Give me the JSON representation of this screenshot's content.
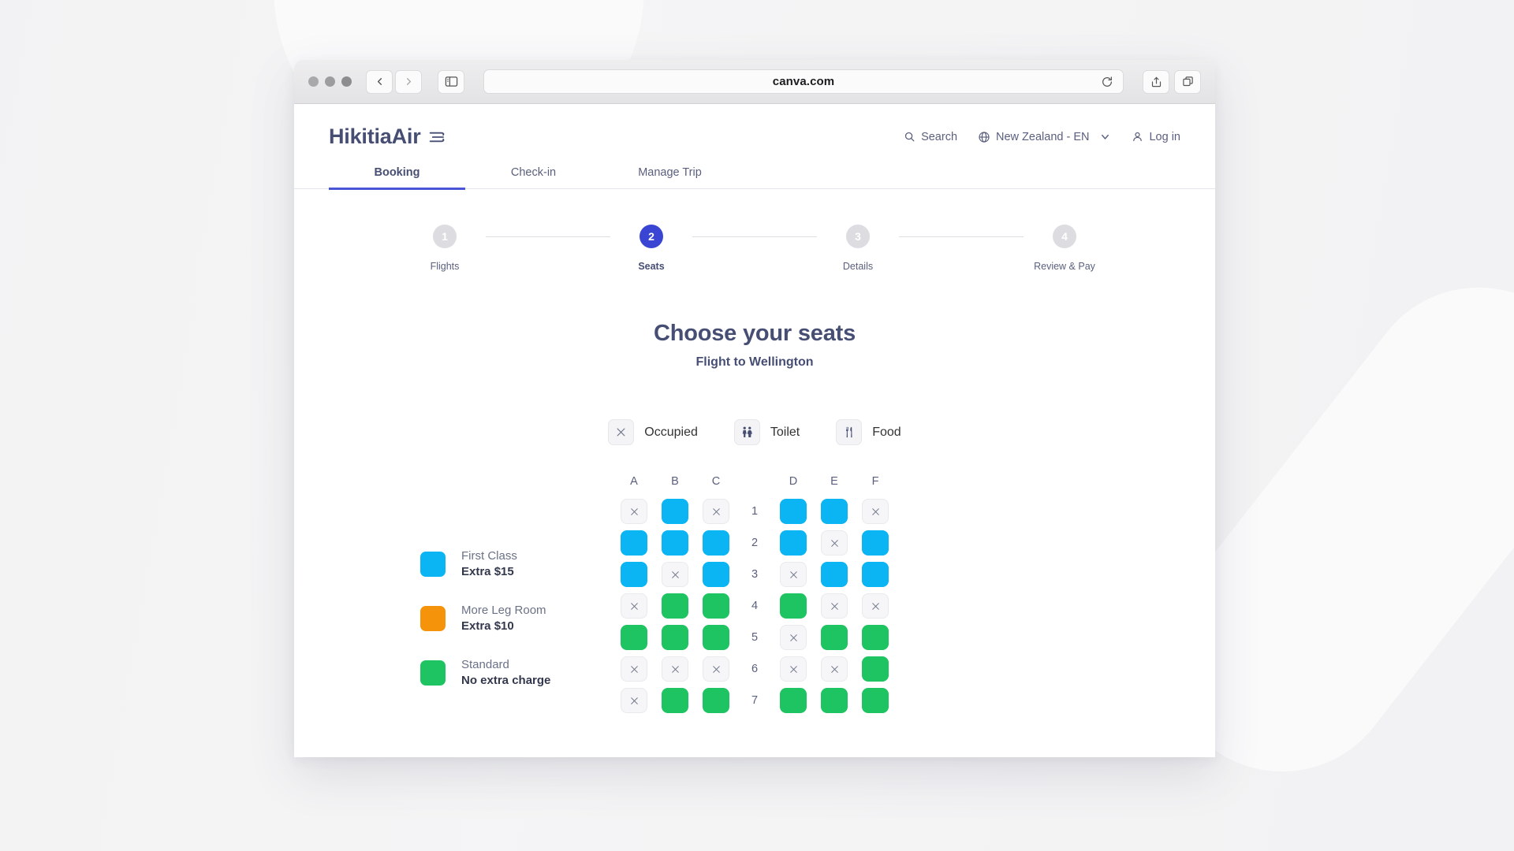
{
  "browser": {
    "url": "canva.com",
    "traffic_lights": [
      "close",
      "minimize",
      "maximize"
    ],
    "back_label": "Back",
    "forward_label": "Forward",
    "sidebar_label": "Show sidebar",
    "reload_label": "Reload",
    "share_label": "Share",
    "tabs_label": "Show tab overview"
  },
  "site": {
    "logo": "HikitiaAir",
    "nav": [
      {
        "label": "Search",
        "icon": "search-icon"
      },
      {
        "label": "New Zealand - EN",
        "icon": "globe-icon",
        "chevron": true
      },
      {
        "label": "Log in",
        "icon": "user-icon"
      }
    ],
    "tabs": [
      {
        "label": "Booking",
        "active": true
      },
      {
        "label": "Check-in",
        "active": false
      },
      {
        "label": "Manage Trip",
        "active": false
      }
    ],
    "stepper": [
      {
        "number": "1",
        "label": "Flights",
        "active": false
      },
      {
        "number": "2",
        "label": "Seats",
        "active": true
      },
      {
        "number": "3",
        "label": "Details",
        "active": false
      },
      {
        "number": "4",
        "label": "Review & Pay",
        "active": false
      }
    ],
    "heading": "Choose your seats",
    "subheading": "Flight to Wellington",
    "icon_legend": [
      {
        "label": "Occupied",
        "icon": "close-x-icon"
      },
      {
        "label": "Toilet",
        "icon": "toilet-icon"
      },
      {
        "label": "Food",
        "icon": "fork-knife-icon"
      }
    ],
    "class_legend": [
      {
        "title": "First Class",
        "price": "Extra $15",
        "color": "#0bb4f2"
      },
      {
        "title": "More Leg Room",
        "price": "Extra $10",
        "color": "#f5940b"
      },
      {
        "title": "Standard",
        "price": "No extra charge",
        "color": "#1fc462"
      }
    ],
    "seat_map": {
      "columns": [
        "A",
        "B",
        "C",
        "D",
        "E",
        "F"
      ],
      "aisle_after": "C",
      "rows": [
        {
          "number": "1",
          "seats": [
            "occupied",
            "blue",
            "occupied",
            "blue",
            "blue",
            "occupied"
          ]
        },
        {
          "number": "2",
          "seats": [
            "blue",
            "blue",
            "blue",
            "blue",
            "occupied",
            "blue"
          ]
        },
        {
          "number": "3",
          "seats": [
            "blue",
            "occupied",
            "blue",
            "occupied",
            "blue",
            "blue"
          ]
        },
        {
          "number": "4",
          "seats": [
            "occupied",
            "green",
            "green",
            "green",
            "occupied",
            "occupied"
          ]
        },
        {
          "number": "5",
          "seats": [
            "green",
            "green",
            "green",
            "occupied",
            "green",
            "green"
          ]
        },
        {
          "number": "6",
          "seats": [
            "occupied",
            "occupied",
            "occupied",
            "occupied",
            "occupied",
            "green"
          ]
        },
        {
          "number": "7",
          "seats": [
            "occupied",
            "green",
            "green",
            "green",
            "green",
            "green"
          ]
        }
      ]
    },
    "colors": {
      "first_class": "#0bb4f2",
      "more_leg_room": "#f5940b",
      "standard": "#1fc462",
      "accent": "#3a45d4",
      "text": "#474e74"
    }
  }
}
